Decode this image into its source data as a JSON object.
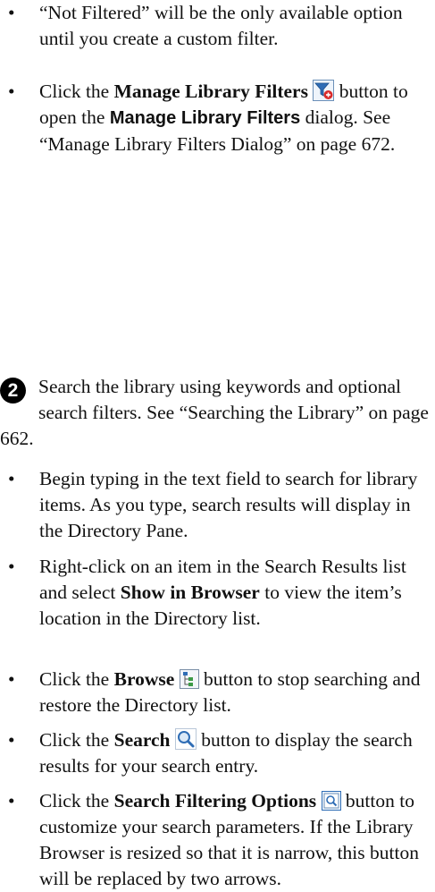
{
  "bullet_char": "•",
  "filters": {
    "not_filtered_text": "“Not Filtered” will be the only available option until you create a custom filter.",
    "manage": {
      "click": "Click the ",
      "button_name": "Manage Library Filters",
      "after_button": " button to open the ",
      "dialog_name": "Manage Library Filters",
      "after_dialog": " dialog. See “Manage Library Filters Dialog” on page 672.",
      "icon": "funnel-plus-icon"
    }
  },
  "step2": {
    "number": "2",
    "text": "Search the library using keywords and optional search filters. See “Searching the Library” on page 662."
  },
  "search_bullets": {
    "typing_text": "Begin typing in the text field to search for library items. As you type, search results will display in the Directory Pane.",
    "rightclick": {
      "before": "Right-click on an item in the Search Results list and select ",
      "bold": "Show in Browser",
      "after": " to view the item’s location in the Directory list."
    },
    "browse": {
      "click": "Click the ",
      "bold": "Browse",
      "after": " button to stop searching and restore the Directory list.",
      "icon": "browse-tree-icon"
    },
    "search": {
      "click": "Click the ",
      "bold": "Search",
      "after": " button to display the search results for your search entry.",
      "icon": "magnifier-icon"
    },
    "filtering": {
      "click": "Click the ",
      "bold": "Search Filtering Options",
      "after": " button to customize your search parameters. If the Library Browser is resized so that it is narrow, this button will be replaced by two arrows.",
      "icon": "search-options-icon"
    }
  }
}
